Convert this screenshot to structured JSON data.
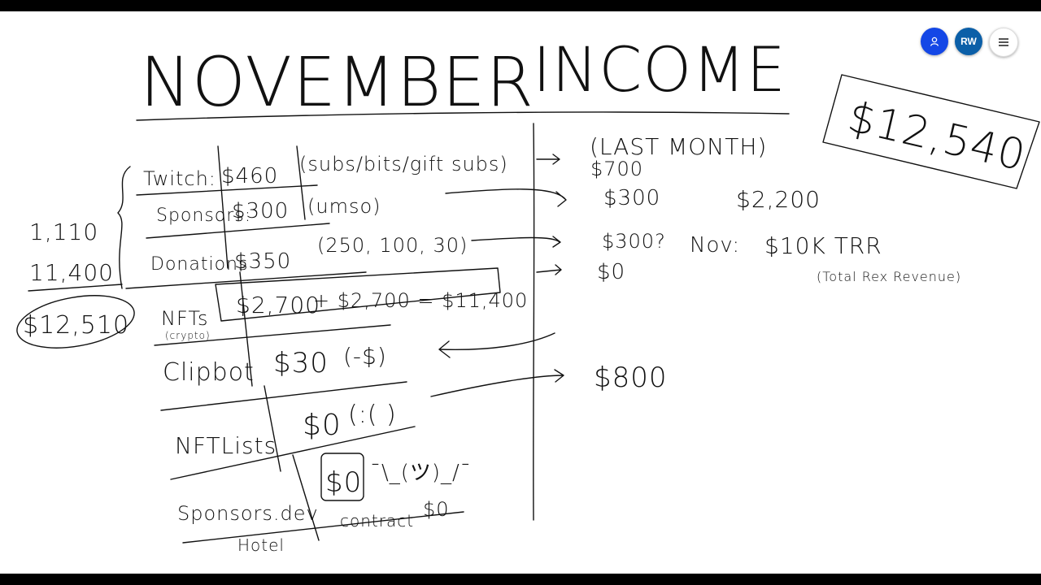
{
  "toolbar": {
    "user_icon": "person-icon",
    "avatar_initials": "RW",
    "menu_icon": "hamburger-menu-icon",
    "user_color": "#1447e6",
    "avatar_color": "#0b5fa8"
  },
  "board": {
    "title_part1": "NOVEMBER",
    "title_part2": "INCOME",
    "total": "$12,540",
    "rows": [
      {
        "name": "Twitch:",
        "amount": "$460",
        "note": "(subs/bits/gift subs)"
      },
      {
        "name": "Sponsors:",
        "amount": "$300",
        "note": "(umso)"
      },
      {
        "name": "Donations",
        "amount": "$350",
        "note": "(250, 100, 30)"
      },
      {
        "name": "NFTs",
        "sub": "(crypto)",
        "amount": "$2,700",
        "calc": "+ $2,700 = $11,400"
      },
      {
        "name": "Clipbot",
        "amount": "$30",
        "note": "(-$)"
      },
      {
        "name": "NFTLists",
        "amount": "$0",
        "note": "(:(  )"
      },
      {
        "name": "Sponsors.dev",
        "amount": "$0",
        "note": "¯\\_(ツ)_/¯",
        "sub": "Hotel",
        "sub_note": "contract",
        "sub_amount": "$0"
      }
    ],
    "side_sum": {
      "line1": "1,110",
      "line2": "11,400",
      "total": "$12,510"
    },
    "last_month": {
      "heading": "(LAST MONTH)",
      "values": [
        "$700",
        "$300",
        "$300?",
        "$0",
        "$800"
      ],
      "extra_amount": "$2,200",
      "nov_label": "Nov:",
      "nov_value": "$10K TRR",
      "trr_note": "(Total Rex Revenue)"
    }
  }
}
